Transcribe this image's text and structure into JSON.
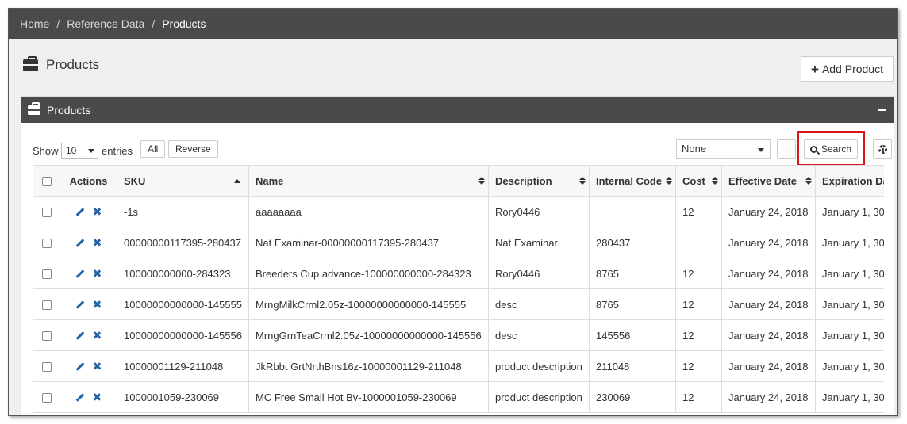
{
  "breadcrumb": [
    {
      "label": "Home"
    },
    {
      "label": "Reference Data"
    },
    {
      "label": "Products"
    }
  ],
  "breadcrumb_separator": "/",
  "page": {
    "title": "Products",
    "add_button_label": "Add Product"
  },
  "panel": {
    "title": "Products"
  },
  "controls": {
    "show_label": "Show",
    "page_length": "10",
    "entries_label": "entries",
    "all_label": "All",
    "reverse_label": "Reverse",
    "filter_value": "None",
    "dots_label": "...",
    "search_label": "Search"
  },
  "colors": {
    "header_bar": "#4a4a4a",
    "action_icon": "#2462a5",
    "highlight": "#d9141b"
  },
  "table": {
    "columns": [
      "Actions",
      "SKU",
      "Name",
      "Description",
      "Internal Code",
      "Cost",
      "Effective Date",
      "Expiration Da"
    ],
    "rows": [
      {
        "sku": "-1s",
        "name": "aaaaaaaa",
        "description": "Rory0446",
        "internal_code": "",
        "cost": "12",
        "effective": "January 24, 2018",
        "expiration": "January 1, 30"
      },
      {
        "sku": "00000000117395-280437",
        "name": "Nat Examinar-00000000117395-280437",
        "description": "Nat Examinar",
        "internal_code": "280437",
        "cost": "",
        "effective": "January 24, 2018",
        "expiration": "January 1, 30"
      },
      {
        "sku": "100000000000-284323",
        "name": "Breeders Cup advance-100000000000-284323",
        "description": "Rory0446",
        "internal_code": "8765",
        "cost": "12",
        "effective": "January 24, 2018",
        "expiration": "January 1, 30"
      },
      {
        "sku": "10000000000000-145555",
        "name": "MrngMilkCrml2.05z-10000000000000-145555",
        "description": "desc",
        "internal_code": "8765",
        "cost": "12",
        "effective": "January 24, 2018",
        "expiration": "January 1, 30"
      },
      {
        "sku": "10000000000000-145556",
        "name": "MrngGrnTeaCrml2.05z-10000000000000-145556",
        "description": "desc",
        "internal_code": "145556",
        "cost": "12",
        "effective": "January 24, 2018",
        "expiration": "January 1, 30"
      },
      {
        "sku": "10000001129-211048",
        "name": "JkRbbt GrtNrthBns16z-10000001129-211048",
        "description": "product description",
        "internal_code": "211048",
        "cost": "12",
        "effective": "January 24, 2018",
        "expiration": "January 1, 30"
      },
      {
        "sku": "1000001059-230069",
        "name": "MC Free Small Hot Bv-1000001059-230069",
        "description": "product description",
        "internal_code": "230069",
        "cost": "12",
        "effective": "January 24, 2018",
        "expiration": "January 1, 30"
      }
    ]
  }
}
